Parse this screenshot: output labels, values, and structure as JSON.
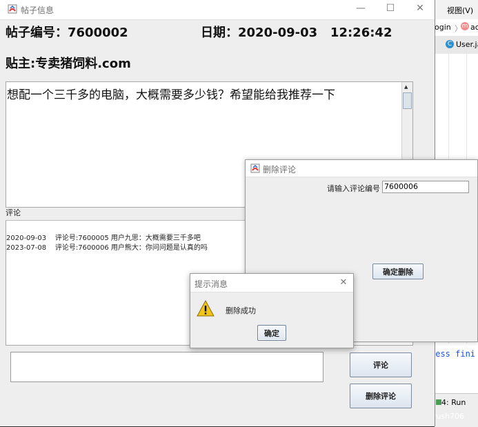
{
  "ide": {
    "menu_item_1": "ɪ",
    "menu_view": "视图(V)",
    "breadcrumb_login": "ogin",
    "breadcrumb_next": "ac",
    "tab_user": "User.ja",
    "console_text": "cess fini",
    "run_tab": "4: Run"
  },
  "main_window": {
    "title": "帖子信息",
    "post_id_label": "帖子编号：7600002",
    "date_label": "日期：2020-09-03   12:26:42",
    "author_label": "贴主:专卖猪饲料.com",
    "content": "想配一个三千多的电脑，大概需要多少钱？希望能给我推荐一下",
    "comments_label": "评论",
    "comments": [
      "2020-09-03    评论号:7600005 用户九思：大概需要三千多吧",
      "2023-07-08    评论号:7600006 用户熊大：你问问题是认真的吗"
    ],
    "comment_input_value": "",
    "comment_button": "评论",
    "delete_comment_button": "删除评论"
  },
  "delete_dialog": {
    "title": "删除评论",
    "prompt_label": "请输入评论编号",
    "input_value": "7600006",
    "confirm_button": "确定删除"
  },
  "message_dialog": {
    "title": "提示消息",
    "message": "删除成功",
    "ok_button": "确定"
  },
  "watermark": "CSDN @rush706",
  "window_controls": {
    "minimize": "—",
    "maximize": "☐",
    "close": "✕"
  }
}
